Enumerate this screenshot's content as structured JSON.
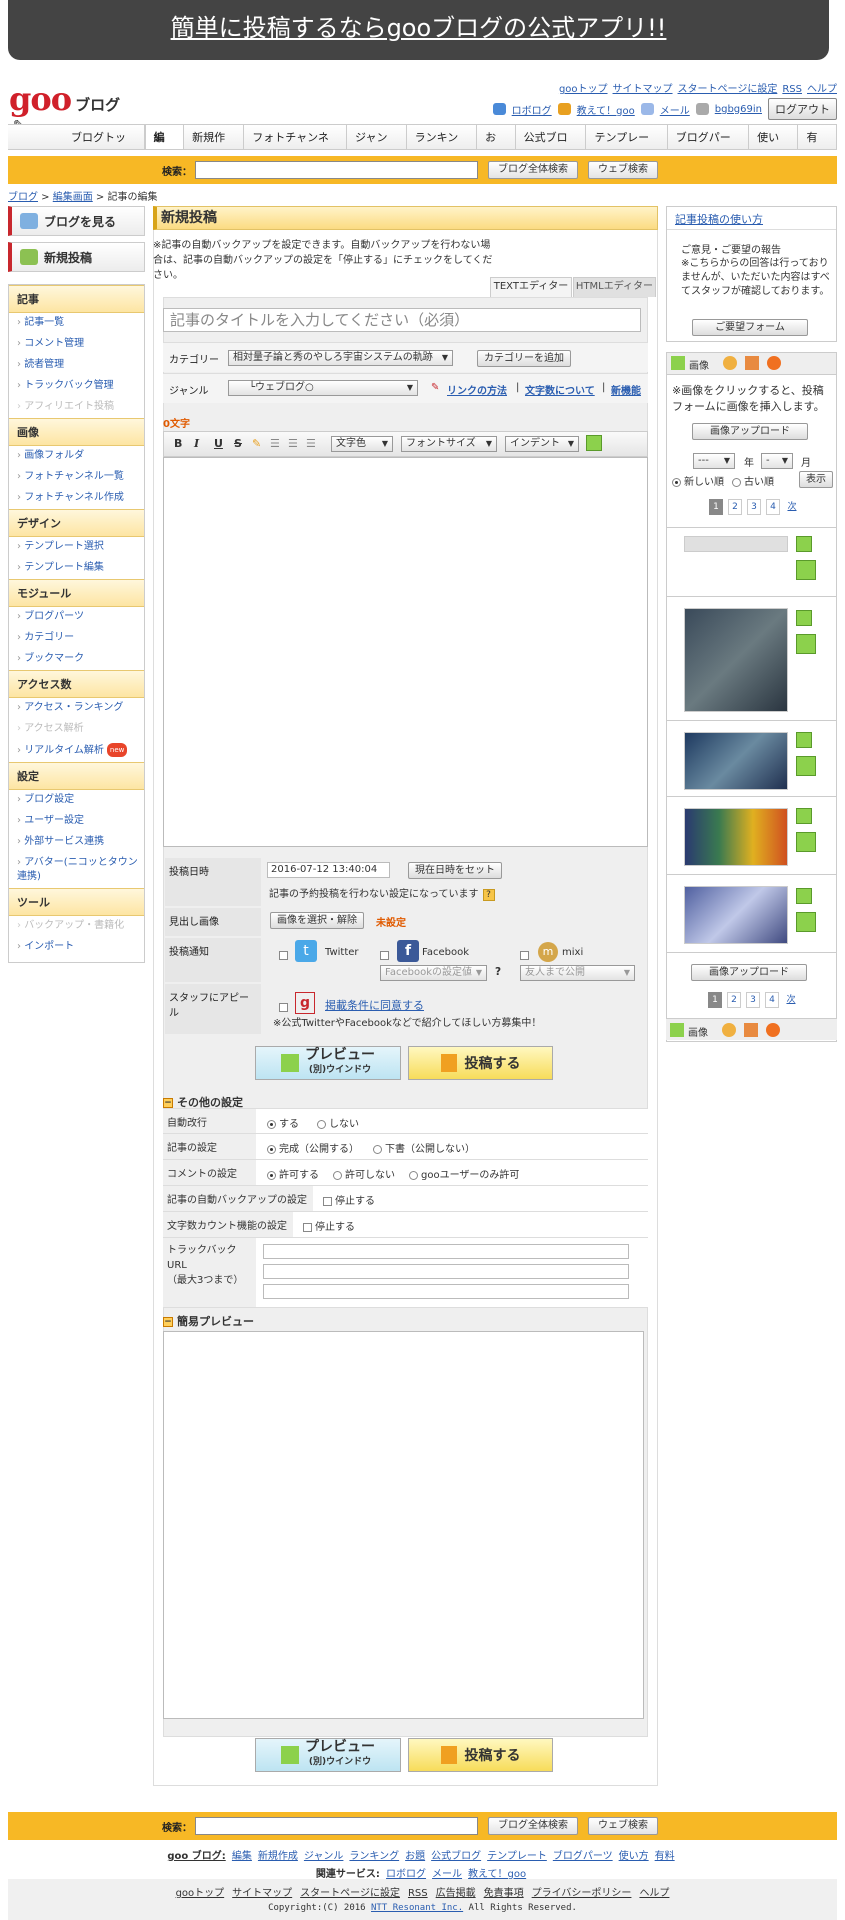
{
  "banner": "簡単に投稿するならgooブログの公式アプリ!!",
  "logo": {
    "main": "goo",
    "sub": "ブログ"
  },
  "toplinks": [
    "gooトップ",
    "サイトマップ",
    "スタートページに設定",
    "RSS",
    "ヘルプ"
  ],
  "user": {
    "robolog": "ロボログ",
    "oshiete": "教えて！goo",
    "mail": "メール",
    "name": "bgbg69in",
    "logout": "ログアウト"
  },
  "nav": [
    "ブログトップ",
    "編集",
    "新規作成",
    "フォトチャンネル",
    "ジャンル",
    "ランキング",
    "お題",
    "公式ブログ",
    "テンプレート",
    "ブログパーツ",
    "使い方",
    "有料"
  ],
  "search": {
    "label": "検索：",
    "btn1": "ブログ全体検索",
    "btn2": "ウェブ検索"
  },
  "breadcrumb": {
    "a": "ブログ",
    "b": "編集画面",
    "c": "記事の編集"
  },
  "side": {
    "view": "ブログを見る",
    "newpost": "新規投稿",
    "sections": [
      {
        "title": "記事",
        "items": [
          "記事一覧",
          "コメント管理",
          "読者管理",
          "トラックバック管理",
          "アフィリエイト投稿"
        ]
      },
      {
        "title": "画像",
        "items": [
          "画像フォルダ",
          "フォトチャンネル一覧",
          "フォトチャンネル作成"
        ]
      },
      {
        "title": "デザイン",
        "items": [
          "テンプレート選択",
          "テンプレート編集"
        ]
      },
      {
        "title": "モジュール",
        "items": [
          "ブログパーツ",
          "カテゴリー",
          "ブックマーク"
        ]
      },
      {
        "title": "アクセス数",
        "items": [
          "アクセス・ランキング",
          "アクセス解析",
          "リアルタイム解析"
        ]
      },
      {
        "title": "設定",
        "items": [
          "ブログ設定",
          "ユーザー設定",
          "外部サービス連携",
          "アバター(ニコッとタウン連携)"
        ]
      },
      {
        "title": "ツール",
        "items": [
          "バックアップ・書籍化",
          "インポート"
        ]
      }
    ],
    "new_badge": "new"
  },
  "main": {
    "title": "新規投稿",
    "note": "※記事の自動バックアップを設定できます。自動バックアップを行わない場合は、記事の自動バックアップの設定を「停止する」にチェックをしてください。",
    "tab_text": "TEXTエディター",
    "tab_html": "HTMLエディター",
    "title_placeholder": "記事のタイトルを入力してください（必須）",
    "category_label": "カテゴリー",
    "category_value": "相対量子論と秀のやしろ宇宙システムの軌跡",
    "category_add": "カテゴリーを追加",
    "genre_label": "ジャンル",
    "genre_value": "└ウェブログ○",
    "link_howto": "リンクの方法",
    "char_about": "文字数について",
    "new_feature": "新機能",
    "char_count": "0文字",
    "toolbar": {
      "b": "B",
      "i": "I",
      "u": "U",
      "s": "S",
      "color": "文字色",
      "font": "フォントサイズ",
      "indent": "インデント"
    },
    "date_label": "投稿日時",
    "date_value": "2016-07-12 13:40:04",
    "date_now": "現在日時をセット",
    "date_note": "記事の予約投稿を行わない設定になっています",
    "img_label": "見出し画像",
    "img_btn": "画像を選択・解除",
    "img_status": "未設定",
    "notify_label": "投稿通知",
    "twitter": "Twitter",
    "facebook": "Facebook",
    "mixi": "mixi",
    "fb_setting": "Facebookの設定値",
    "friends": "友人まで公開",
    "appeal_label": "スタッフにアピール",
    "appeal_agree": "掲載条件に同意する",
    "appeal_note": "※公式TwitterやFacebookなどで紹介してほしい方募集中！",
    "preview_btn": "プレビュー",
    "preview_sub": "(別)ウインドウ",
    "post_btn": "投稿する",
    "other_title": "その他の設定",
    "opts": [
      {
        "k": "自動改行",
        "v": [
          "する",
          "しない"
        ]
      },
      {
        "k": "記事の設定",
        "v": [
          "完成（公開する）",
          "下書（公開しない）"
        ]
      },
      {
        "k": "コメントの設定",
        "v": [
          "許可する",
          "許可しない",
          "gooユーザーのみ許可"
        ]
      },
      {
        "k": "記事の自動バックアップの設定",
        "v": [
          "停止する"
        ]
      },
      {
        "k": "文字数カウント機能の設定",
        "v": [
          "停止する"
        ]
      }
    ],
    "tb_label": "トラックバックURL\n（最大3つまで）",
    "preview_title": "簡易プレビュー"
  },
  "right": {
    "help": "記事投稿の使い方",
    "opinion": "ご意見・ご要望の報告",
    "opinion_note": "※こちらからの回答は行っておりませんが、いただいた内容はすべてスタッフが確認しております。",
    "form": "ご要望フォーム",
    "img_tab": "画像",
    "img_note": "※画像をクリックすると、投稿フォームに画像を挿入します。",
    "upload": "画像アップロード",
    "year": "年",
    "month": "月",
    "sel": "---",
    "sel2": "-",
    "new": "新しい順",
    "old": "古い順",
    "show": "表示",
    "pages": [
      "1",
      "2",
      "3",
      "4"
    ],
    "next": "次"
  },
  "footer": {
    "brand": "goo ブログ:",
    "links": [
      "編集",
      "新規作成",
      "ジャンル",
      "ランキング",
      "お題",
      "公式ブログ",
      "テンプレート",
      "ブログパーツ",
      "使い方",
      "有料"
    ],
    "related": "関連サービス:",
    "rel": [
      "ロボログ",
      "メール",
      "教えて！goo"
    ],
    "bottom": [
      "gooトップ",
      "サイトマップ",
      "スタートページに設定",
      "RSS",
      "広告掲載",
      "免責事項",
      "プライバシーポリシー",
      "ヘルプ"
    ],
    "copy": "Copyright:(C) 2016 ",
    "ntt": "NTT Resonant Inc.",
    "rights": " All Rights Reserved."
  },
  "colors": {
    "accent": "#f7b825",
    "red": "#c8272d",
    "link": "#2a5db0"
  }
}
